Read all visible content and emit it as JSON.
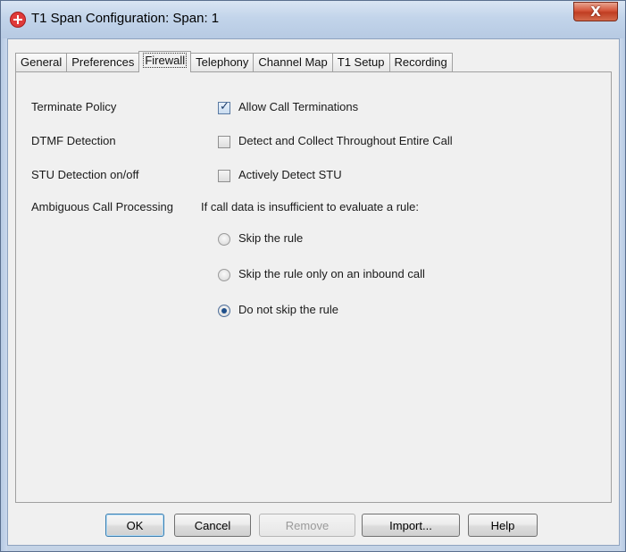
{
  "window": {
    "title": "T1 Span Configuration: Span: 1",
    "close_glyph": "X"
  },
  "tabs": [
    {
      "label": "General"
    },
    {
      "label": "Preferences"
    },
    {
      "label": "Firewall"
    },
    {
      "label": "Telephony"
    },
    {
      "label": "Channel Map"
    },
    {
      "label": "T1 Setup"
    },
    {
      "label": "Recording"
    }
  ],
  "active_tab": "Firewall",
  "firewall": {
    "terminate_policy": {
      "label": "Terminate Policy",
      "option": "Allow Call Terminations",
      "checked": true
    },
    "dtmf_detection": {
      "label": "DTMF Detection",
      "option": "Detect and Collect Throughout Entire Call",
      "checked": false
    },
    "stu_detection": {
      "label": "STU Detection on/off",
      "option": "Actively Detect STU",
      "checked": false
    },
    "ambiguous": {
      "label": "Ambiguous Call Processing",
      "description": "If call data is insufficient to evaluate a rule:",
      "options": [
        {
          "label": "Skip the rule",
          "selected": false
        },
        {
          "label": "Skip the rule only on an inbound call",
          "selected": false
        },
        {
          "label": "Do not skip the rule",
          "selected": true
        }
      ]
    }
  },
  "buttons": {
    "ok": "OK",
    "cancel": "Cancel",
    "remove": "Remove",
    "import": "Import...",
    "help": "Help"
  },
  "icons": {
    "app": "span-config-icon",
    "close": "close-icon"
  },
  "colors": {
    "titlebar": "#c2d4ea",
    "close_button": "#c03d22",
    "panel_background": "#f0f0f0",
    "default_button_border": "#3c7fb1"
  }
}
